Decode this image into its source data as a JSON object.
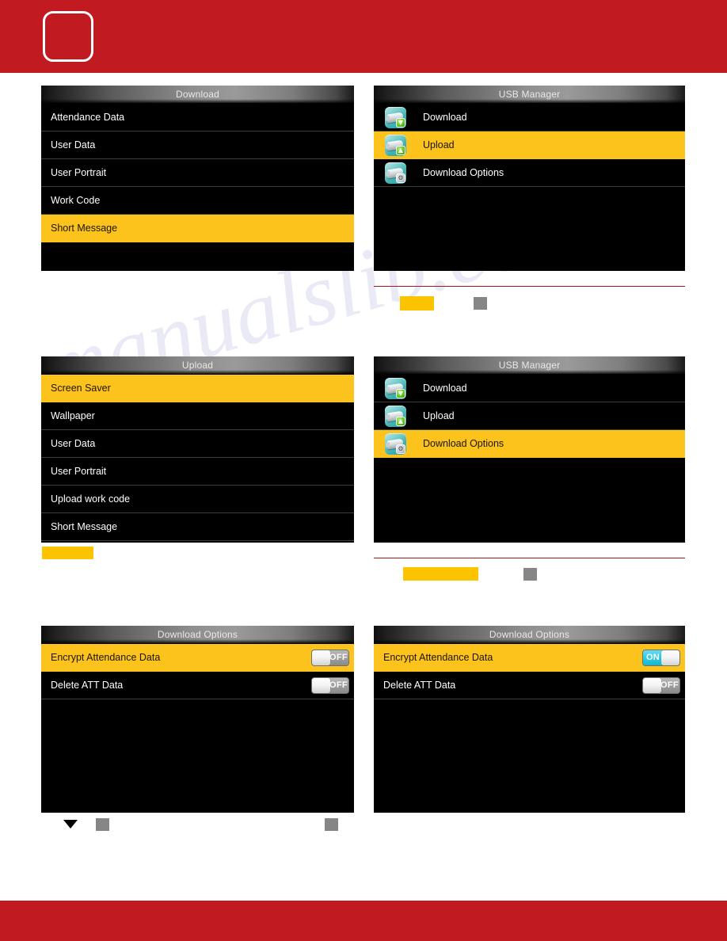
{
  "header": {
    "logo_alt": "logo-placeholder"
  },
  "watermark": {
    "text": "manualslib.com"
  },
  "panels": [
    {
      "id": "download-menu",
      "title": "Download",
      "rows": [
        {
          "label": "Attendance Data",
          "selected": false
        },
        {
          "label": "User Data",
          "selected": false
        },
        {
          "label": "User Portrait",
          "selected": false
        },
        {
          "label": "Work Code",
          "selected": false
        },
        {
          "label": "Short Message",
          "selected": true
        }
      ]
    },
    {
      "id": "usb-manager-upload",
      "title": "USB Manager",
      "rows": [
        {
          "label": "Download",
          "selected": false,
          "icon": "usb-download-icon",
          "badge": "▼"
        },
        {
          "label": "Upload",
          "selected": true,
          "icon": "usb-upload-icon",
          "badge": "▲"
        },
        {
          "label": "Download Options",
          "selected": false,
          "icon": "usb-options-icon",
          "badge": "⚙"
        }
      ]
    },
    {
      "id": "upload-menu",
      "title": "Upload",
      "rows": [
        {
          "label": "Screen Saver",
          "selected": true
        },
        {
          "label": "Wallpaper",
          "selected": false
        },
        {
          "label": "User Data",
          "selected": false
        },
        {
          "label": "User Portrait",
          "selected": false
        },
        {
          "label": "Upload work code",
          "selected": false
        },
        {
          "label": "Short Message",
          "selected": false
        }
      ]
    },
    {
      "id": "usb-manager-options",
      "title": "USB Manager",
      "rows": [
        {
          "label": "Download",
          "selected": false,
          "icon": "usb-download-icon",
          "badge": "▼"
        },
        {
          "label": "Upload",
          "selected": false,
          "icon": "usb-upload-icon",
          "badge": "▲"
        },
        {
          "label": "Download Options",
          "selected": true,
          "icon": "usb-options-icon",
          "badge": "⚙"
        }
      ]
    },
    {
      "id": "download-options-off",
      "title": "Download Options",
      "rows": [
        {
          "label": "Encrypt Attendance Data",
          "selected": true,
          "toggle": "OFF"
        },
        {
          "label": "Delete ATT Data",
          "selected": false,
          "toggle": "OFF"
        }
      ]
    },
    {
      "id": "download-options-on",
      "title": "Download Options",
      "rows": [
        {
          "label": "Encrypt Attendance Data",
          "selected": true,
          "toggle": "ON"
        },
        {
          "label": "Delete ATT Data",
          "selected": false,
          "toggle": "OFF"
        }
      ]
    }
  ],
  "colors": {
    "brand_red": "#c11a20",
    "highlight_yellow": "#fcc31c",
    "marker_yellow": "#fcc400",
    "marker_gray": "#868686",
    "rule_red": "#9e1a1a",
    "screen_black": "#000000",
    "toggle_on_cyan": "#2ec8e2"
  },
  "markers": {
    "triangle_glyph": "▼"
  }
}
